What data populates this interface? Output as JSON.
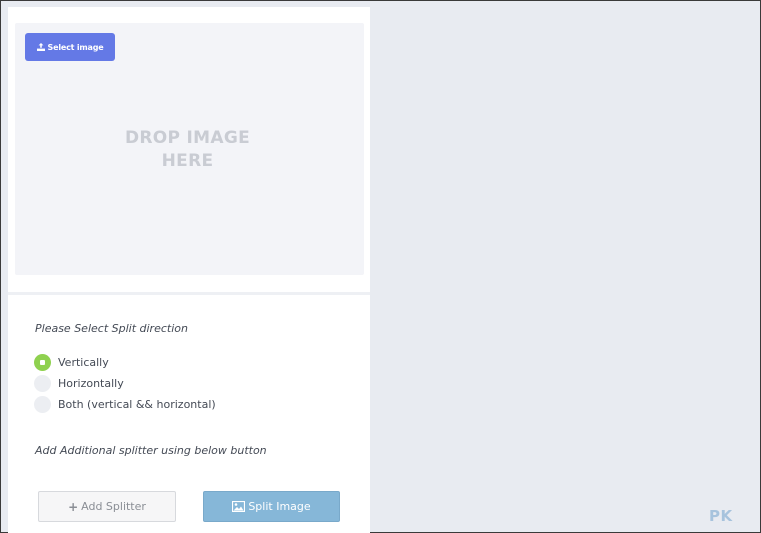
{
  "dropzone": {
    "select_button_label": "Select image",
    "select_icon": "upload-icon",
    "drop_text": "DROP IMAGE HERE"
  },
  "direction": {
    "prompt": "Please Select Split direction",
    "selected": "Vertically",
    "options": [
      {
        "label": "Vertically",
        "checked": true
      },
      {
        "label": "Horizontally",
        "checked": false
      },
      {
        "label": "Both (vertical && horizontal)",
        "checked": false
      }
    ]
  },
  "splitter": {
    "prompt": "Add Additional splitter using below button"
  },
  "buttons": {
    "add_splitter_label": "Add Splitter",
    "add_icon": "plus-icon",
    "split_image_label": "Split Image",
    "split_icon": "image-icon"
  },
  "colors": {
    "select_button": "#6479e6",
    "radio_checked": "#8fd14f",
    "split_button": "#86b7d8",
    "background": "#e8ebf1"
  },
  "watermark": "PK"
}
